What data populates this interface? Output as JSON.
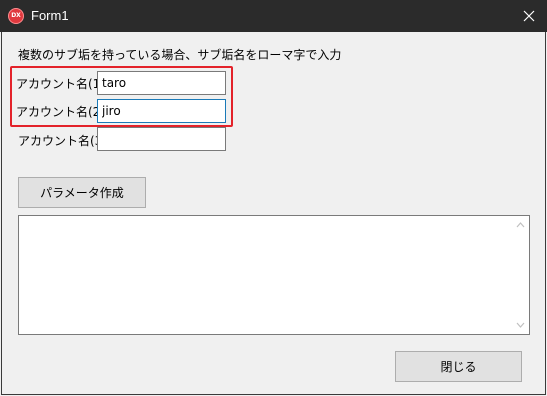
{
  "window": {
    "title": "Form1",
    "app_icon_text": "DX",
    "close_glyph": "✕"
  },
  "form": {
    "instruction": "複数のサブ垢を持っている場合、サブ垢名をローマ字で入力",
    "accounts": [
      {
        "label": "アカウント名(1)",
        "value": "taro"
      },
      {
        "label": "アカウント名(2)",
        "value": "jiro"
      },
      {
        "label": "アカウント名(3)",
        "value": ""
      }
    ],
    "generate_button": "パラメータ作成",
    "output_text": "",
    "close_button": "閉じる"
  },
  "colors": {
    "titlebar": "#2b2b2b",
    "highlight": "#e3222a",
    "focus_border": "#1a7ab8",
    "button_bg": "#e1e1e1"
  }
}
